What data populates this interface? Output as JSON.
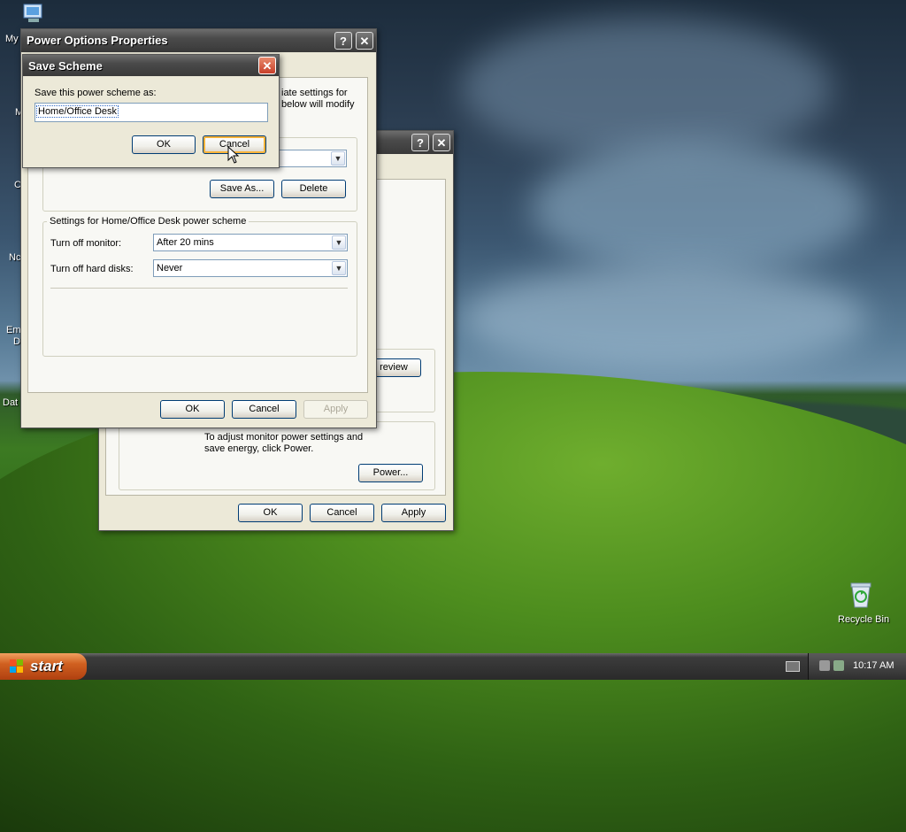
{
  "desktop": {
    "icons": [
      {
        "label": "My"
      },
      {
        "label": "M"
      },
      {
        "label": "C"
      },
      {
        "label": "Nc"
      },
      {
        "label": "Em"
      },
      {
        "label": "D"
      },
      {
        "label": "Dat"
      }
    ],
    "recycle_bin": {
      "label": "Recycle Bin",
      "icon": "recycle-bin-icon"
    }
  },
  "back_window": {
    "buttons": {
      "preview": "review",
      "power": "Power...",
      "ok": "OK",
      "cancel": "Cancel",
      "apply": "Apply"
    },
    "monitor_text": "To adjust monitor power settings and save energy, click Power."
  },
  "power_window": {
    "title": "Power Options Properties",
    "intro_line1": "iate settings for",
    "intro_line2": "below will modify",
    "save_as": "Save As...",
    "delete": "Delete",
    "settings_group": "Settings for Home/Office Desk power scheme",
    "monitor_label": "Turn off monitor:",
    "monitor_value": "After 20 mins",
    "disks_label": "Turn off hard disks:",
    "disks_value": "Never",
    "ok": "OK",
    "cancel": "Cancel",
    "apply": "Apply"
  },
  "save_dialog": {
    "title": "Save Scheme",
    "prompt": "Save this power scheme as:",
    "value": "Home/Office Desk",
    "ok": "OK",
    "cancel": "Cancel"
  },
  "taskbar": {
    "start": "start",
    "clock": "10:17 AM"
  }
}
